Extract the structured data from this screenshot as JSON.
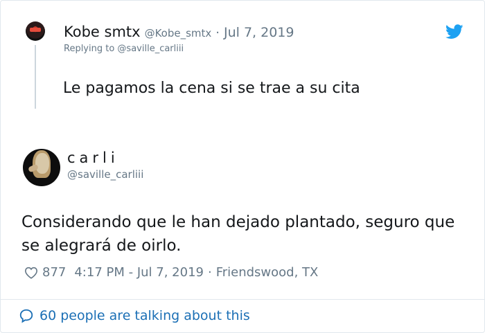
{
  "colors": {
    "text": "#14171a",
    "secondary": "#657786",
    "link": "#1b6fb5",
    "twitter_blue": "#1da1f2",
    "border": "#e1e8ed"
  },
  "parent_tweet": {
    "author_name": "Kobe smtx",
    "author_handle": "@Kobe_smtx",
    "separator": "·",
    "date": "Jul 7, 2019",
    "replying_to": "Replying to @saville_carliii",
    "text": "Le pagamos la cena si se trae a su cita"
  },
  "main_tweet": {
    "author_name": "carli",
    "author_handle": "@saville_carliii",
    "text": "Considerando que le han dejado plantado, seguro que se alegrará de oirlo.",
    "likes": "877",
    "time_date": "4:17 PM - Jul 7, 2019",
    "separator": "·",
    "location": "Friendswood, TX"
  },
  "footer": {
    "talking_label": "60 people are talking about this"
  },
  "icons": {
    "brand": "twitter-bird-icon",
    "like": "heart-icon",
    "conversation": "speech-bubble-icon"
  }
}
